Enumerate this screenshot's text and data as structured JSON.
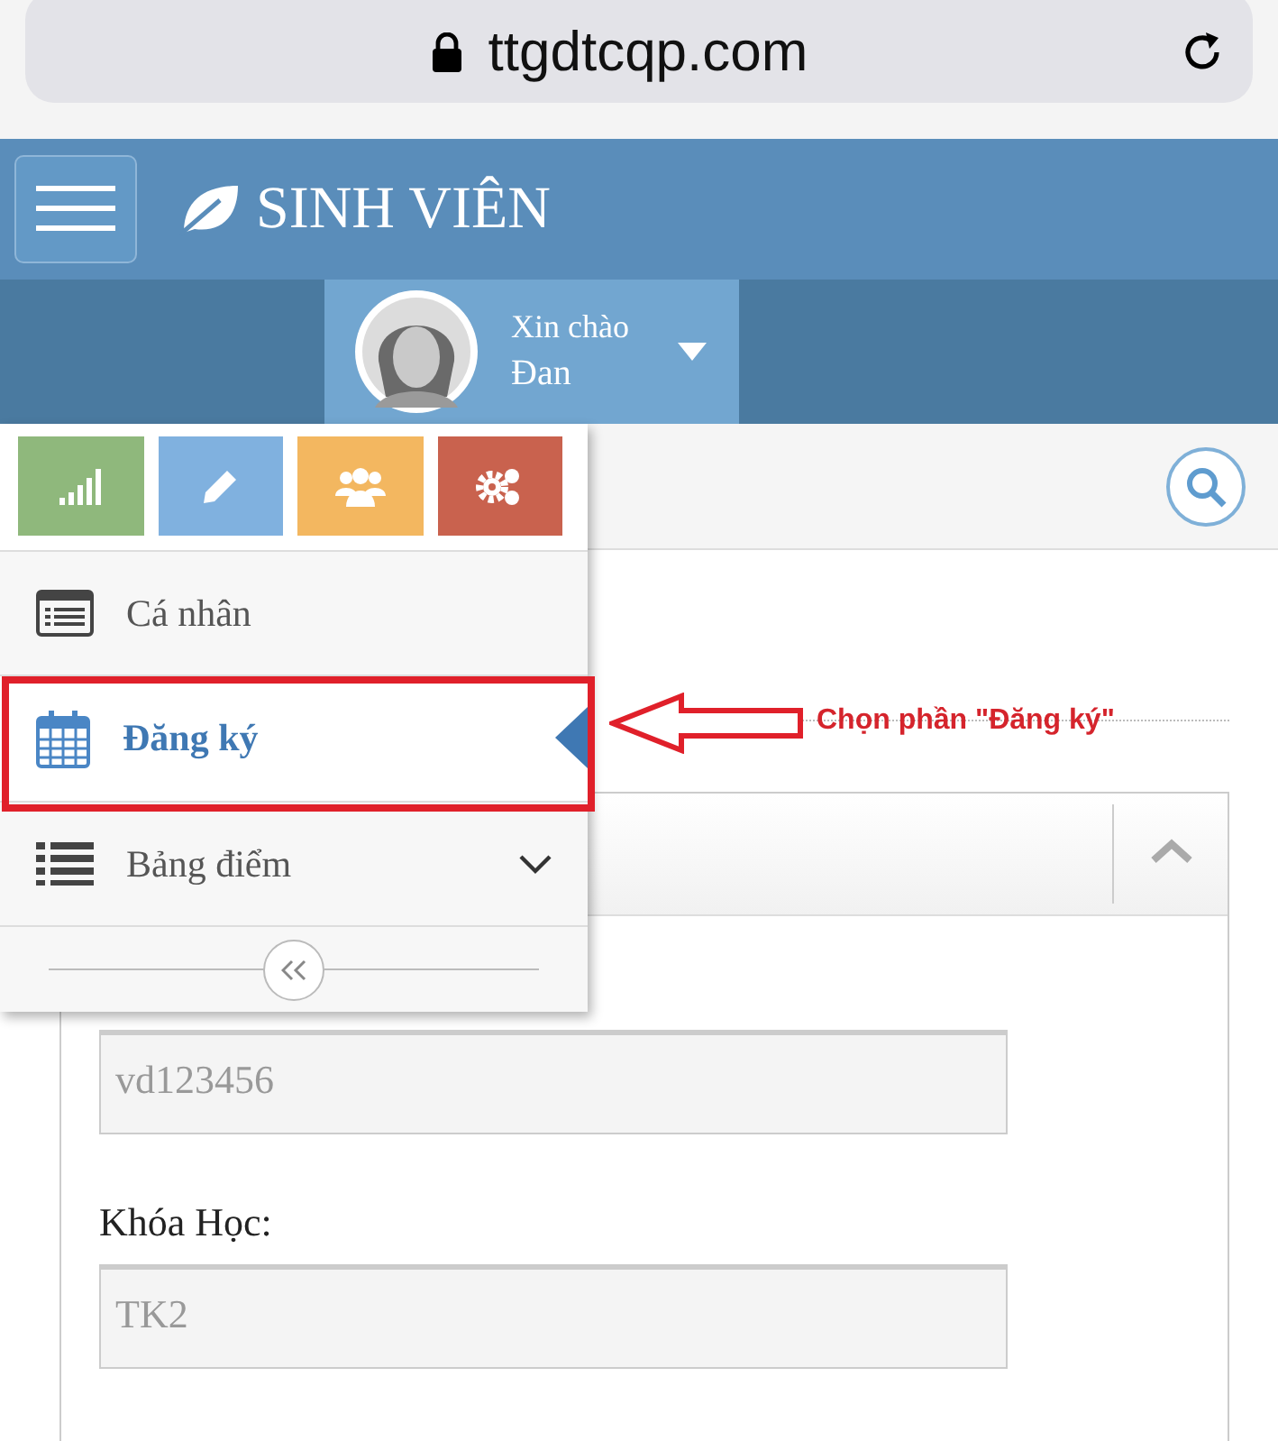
{
  "browser": {
    "url": "ttgdtcqp.com"
  },
  "header": {
    "title": "SINH VIÊN"
  },
  "user": {
    "greeting": "Xin chào",
    "name": "Đan"
  },
  "menu": {
    "tiles": [
      {
        "kind": "signal",
        "color": "#8fb87c"
      },
      {
        "kind": "pencil",
        "color": "#80b1df"
      },
      {
        "kind": "group",
        "color": "#f3b760"
      },
      {
        "kind": "gears",
        "color": "#c9624e"
      }
    ],
    "items": [
      {
        "kind": "list",
        "label": "Cá nhân",
        "selected": false,
        "expandable": false
      },
      {
        "kind": "calendar",
        "label": "Đăng ký",
        "selected": true,
        "expandable": false
      },
      {
        "kind": "bullets",
        "label": "Bảng điểm",
        "selected": false,
        "expandable": true
      }
    ]
  },
  "annotation": {
    "text": "Chọn phần \"Đăng ký\""
  },
  "form": {
    "fields": [
      {
        "value": "vd123456"
      },
      {
        "label": "Khóa Học:",
        "value": "TK2"
      }
    ]
  }
}
